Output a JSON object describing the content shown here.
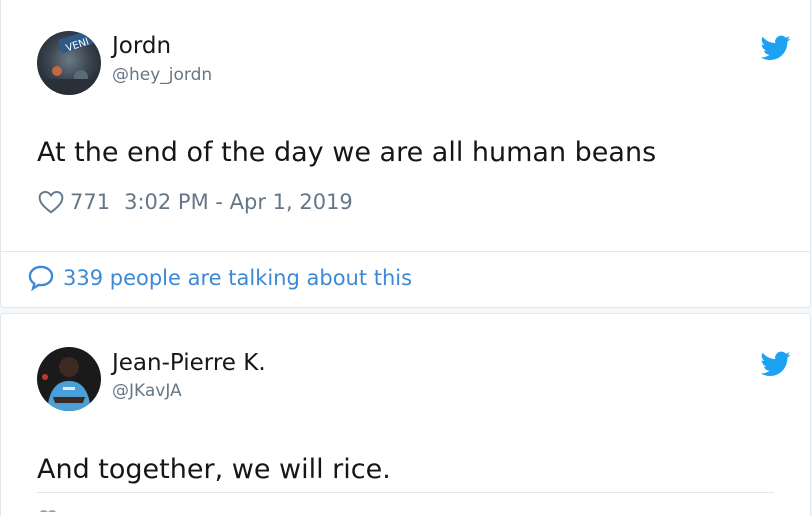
{
  "tweets": [
    {
      "author_name": "Jordn",
      "author_handle": "@hey_jordn",
      "text": "At the end of the day we are all human beans",
      "likes": "771",
      "timestamp": "3:02 PM - Apr 1, 2019",
      "talking": "339 people are talking about this",
      "avatar_badge": "VENI"
    },
    {
      "author_name": "Jean-Pierre K.",
      "author_handle": "@JKavJA",
      "text": "And together, we will rice."
    }
  ],
  "colors": {
    "twitter_blue": "#1da1f2",
    "link_blue": "#3b8ad8",
    "text": "#14171a",
    "muted": "#657786"
  },
  "icons": {
    "brand": "twitter-bird-icon",
    "like": "heart-icon",
    "reply": "speech-bubble-icon"
  }
}
